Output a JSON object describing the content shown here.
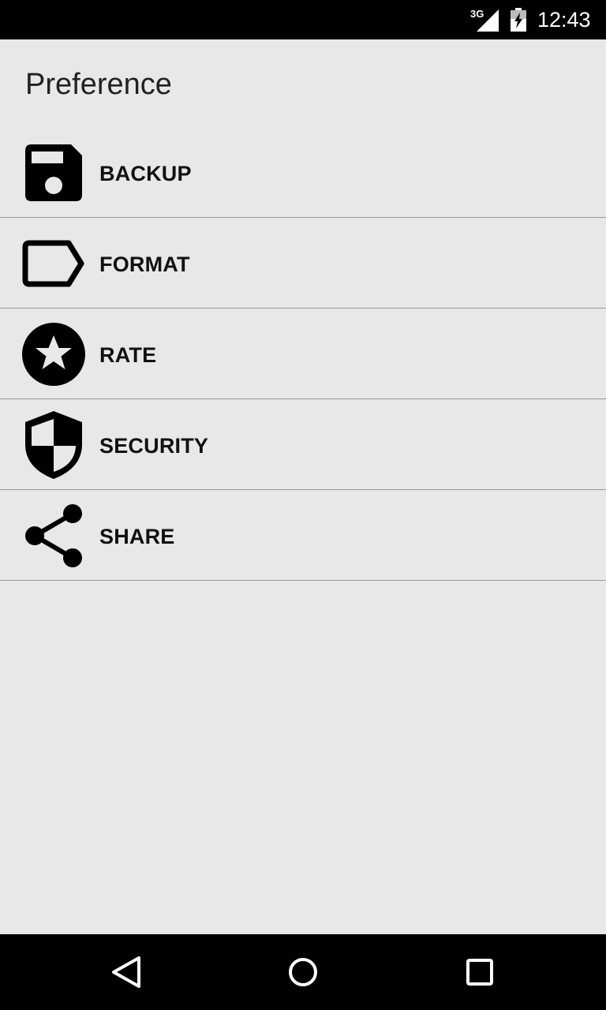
{
  "status_bar": {
    "network": "3G",
    "time": "12:43"
  },
  "page": {
    "title": "Preference"
  },
  "menu": {
    "items": [
      {
        "label": "BACKUP",
        "icon": "floppy-disk-icon"
      },
      {
        "label": "FORMAT",
        "icon": "label-tag-icon"
      },
      {
        "label": "RATE",
        "icon": "star-circle-icon"
      },
      {
        "label": "SECURITY",
        "icon": "shield-icon"
      },
      {
        "label": "SHARE",
        "icon": "share-icon"
      }
    ]
  },
  "nav_bar": {
    "buttons": [
      "back-icon",
      "home-icon",
      "recents-icon"
    ]
  },
  "colors": {
    "background": "#e8e8e8",
    "bars": "#000000",
    "divider": "#9a9a9a",
    "text": "#111111"
  }
}
